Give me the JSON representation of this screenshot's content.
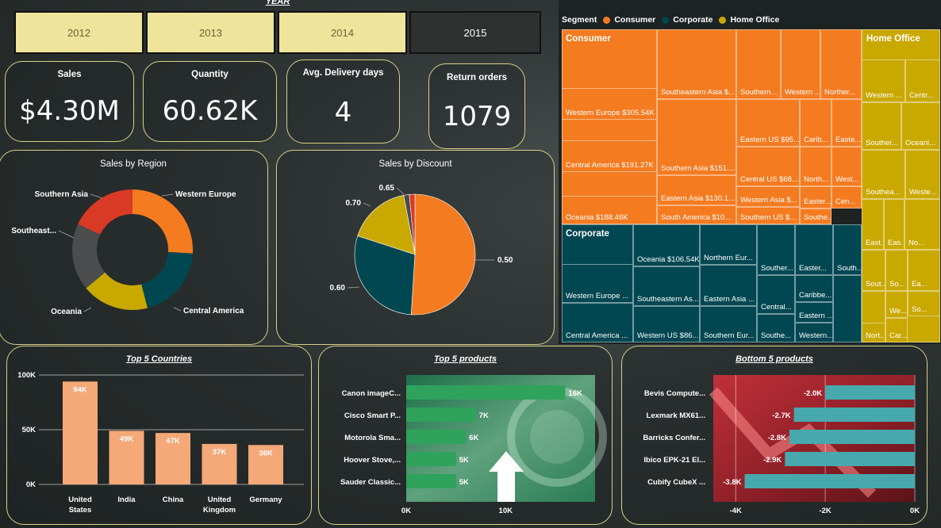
{
  "year_slicer": {
    "title": "YEAR",
    "years": [
      "2012",
      "2013",
      "2014",
      "2015"
    ],
    "selected": "2015"
  },
  "kpis": {
    "sales": {
      "label": "Sales",
      "value": "$4.30M"
    },
    "quantity": {
      "label": "Quantity",
      "value": "60.62K"
    },
    "delivery": {
      "label": "Avg. Delivery days",
      "value": "4"
    },
    "returns": {
      "label": "Return orders",
      "value": "1079"
    }
  },
  "colors": {
    "orange": "#f47b20",
    "teal": "#004752",
    "gold": "#c9a800",
    "gray": "#4a4c4d",
    "red": "#d93a25",
    "bar_salmon": "#f5a878",
    "bar_green": "#2fa25c",
    "bar_cyan": "#47a9ad"
  },
  "treemap": {
    "legend_title": "Segment",
    "legend": [
      {
        "name": "Consumer",
        "color": "#f47b20"
      },
      {
        "name": "Corporate",
        "color": "#004752"
      },
      {
        "name": "Home Office",
        "color": "#c9a800"
      }
    ],
    "headers": {
      "consumer": "Consumer",
      "corporate": "Corporate",
      "home_office": "Home Office"
    },
    "cells": [
      "Western Europe $305.54K",
      "Central America $191.27K",
      "Oceania $188.46K",
      "Southeastern Asia $...",
      "Southern Asia $151....",
      "Eastern Asia $130.1...",
      "South America $10...",
      "Southern...",
      "Western ...",
      "Norther...",
      "Eastern US $95....",
      "Central US $68....",
      "Western Asia $...",
      "Southern US $...",
      "Carib...",
      "Easte...",
      "North...",
      "West...",
      "Easter...",
      "Cen...",
      "Southe...",
      "Western Europe ...",
      "Central America ...",
      "Oceania $106.54K",
      "Southeastern As...",
      "Western US $86....",
      "Northern Eur...",
      "Eastern Asia ...",
      "Southern Eur...",
      "Souther...",
      "Central...",
      "Southe...",
      "Easter...",
      "Caribbe...",
      "Eastern ...",
      "Western...",
      "South...",
      "Western ...",
      "Centr...",
      "Souther...",
      "Oceani...",
      "Southea...",
      "Weste...",
      "East...",
      "Eas...",
      "No...",
      "Sout...",
      "So...",
      "Ea...",
      "Centr...",
      "We...",
      "So...",
      "Car...",
      "Nort..."
    ]
  },
  "sales_by_region": {
    "title": "Sales by Region",
    "chart_data": {
      "type": "pie",
      "style": "donut",
      "labels": [
        "Western Europe",
        "Central America",
        "Oceania",
        "Southeast...",
        "Southern Asia"
      ],
      "values": [
        26,
        20,
        18,
        18,
        18
      ],
      "colors": [
        "#f47b20",
        "#004752",
        "#c9a800",
        "#4a4c4d",
        "#d93a25"
      ]
    }
  },
  "sales_by_discount": {
    "title": "Sales by Discount",
    "chart_data": {
      "type": "pie",
      "labels": [
        "0.50",
        "0.60",
        "0.70",
        "0.65",
        ""
      ],
      "values": [
        51,
        29,
        17,
        1.5,
        1.5
      ],
      "colors": [
        "#f47b20",
        "#004752",
        "#c9a800",
        "#4a4c4d",
        "#d93a25"
      ]
    }
  },
  "top_countries": {
    "title": "Top 5 Countries",
    "chart_data": {
      "type": "bar",
      "categories": [
        "United States",
        "India",
        "China",
        "United Kingdom",
        "Germany"
      ],
      "category_lines": [
        [
          "United",
          "States"
        ],
        [
          "India"
        ],
        [
          "China"
        ],
        [
          "United",
          "Kingdom"
        ],
        [
          "Germany"
        ]
      ],
      "values": [
        94,
        49,
        47,
        37,
        36
      ],
      "value_labels": [
        "94K",
        "49K",
        "47K",
        "37K",
        "36K"
      ],
      "yticks": [
        "100K",
        "50K",
        "0K"
      ],
      "ylim": [
        0,
        100
      ]
    }
  },
  "top_products": {
    "title": "Top 5 products",
    "chart_data": {
      "type": "bar",
      "orientation": "horizontal",
      "categories": [
        "Canon imageC...",
        "Cisco Smart P...",
        "Motorola Sma...",
        "Hoover Stove,...",
        "Sauder Classic..."
      ],
      "values": [
        16,
        7,
        6,
        5,
        5
      ],
      "value_labels": [
        "16K",
        "7K",
        "6K",
        "5K",
        "5K"
      ],
      "xticks": [
        "0K",
        "10K"
      ],
      "xlim": [
        0,
        19
      ]
    }
  },
  "bottom_products": {
    "title": "Bottom 5 products",
    "chart_data": {
      "type": "bar",
      "orientation": "horizontal",
      "categories": [
        "Bevis Compute...",
        "Lexmark MX61...",
        "Barricks Confer...",
        "Ibico EPK-21 El...",
        "Cubify CubeX ..."
      ],
      "values": [
        -2.0,
        -2.7,
        -2.8,
        -2.9,
        -3.8
      ],
      "value_labels": [
        "-2.0K",
        "-2.7K",
        "-2.8K",
        "-2.9K",
        "-3.8K"
      ],
      "xticks": [
        "-4K",
        "-2K",
        "0K"
      ],
      "xlim": [
        -4.5,
        0
      ]
    }
  }
}
